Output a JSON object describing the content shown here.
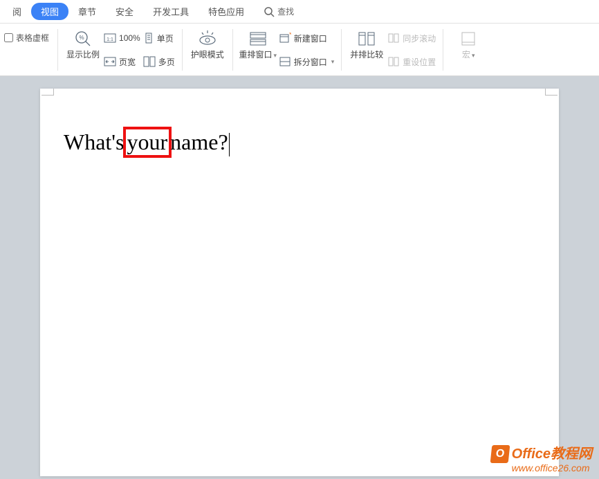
{
  "menubar": {
    "tabs": [
      "阅",
      "视图",
      "章节",
      "安全",
      "开发工具",
      "特色应用"
    ],
    "active_index": 1,
    "search_label": "查找"
  },
  "ribbon": {
    "table_checkbox": "表格虚框",
    "zoom_group": {
      "zoom_ratio": "显示比例",
      "hundred": "100%",
      "page_width": "页宽",
      "single_page": "单页",
      "multi_page": "多页"
    },
    "eye_mode": "护眼模式",
    "window_group": {
      "rearrange": "重排窗口",
      "new_window": "新建窗口",
      "split_window": "拆分窗口"
    },
    "compare_group": {
      "side_by_side": "并排比较",
      "sync_scroll": "同步滚动",
      "reset_position": "重设位置"
    },
    "macros": "宏"
  },
  "document": {
    "text_parts": [
      "What's",
      " your ",
      "name?"
    ],
    "highlight_index": 1
  },
  "watermark": {
    "title": "Office教程网",
    "url": "www.office26.com"
  }
}
